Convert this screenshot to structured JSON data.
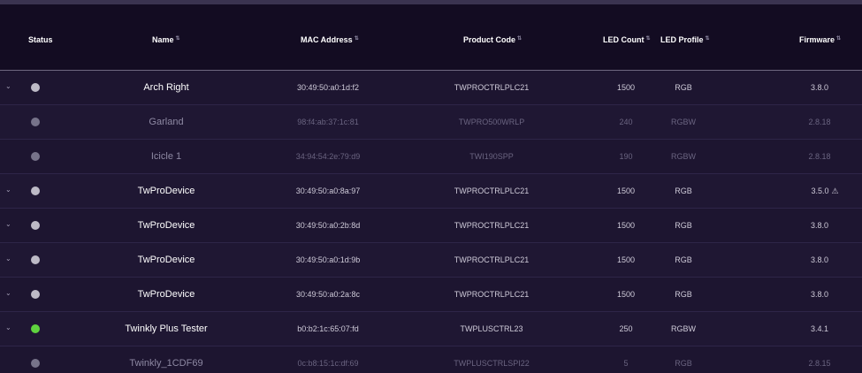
{
  "columns": {
    "status": "Status",
    "name": "Name",
    "mac": "MAC Address",
    "product": "Product Code",
    "led_count": "LED Count",
    "led_profile": "LED Profile",
    "firmware": "Firmware"
  },
  "colors": {
    "online_gray": "#bdbac6",
    "offline_gray": "#77738a",
    "online_green": "#5fd33f",
    "accent_bg": "#1d1530"
  },
  "rows": [
    {
      "name": "Arch Right",
      "mac": "30:49:50:a0:1d:f2",
      "product": "TWPROCTRLPLC21",
      "led_count": "1500",
      "led_profile": "RGB",
      "firmware": "3.8.0",
      "warning": "",
      "chevron": "⌄",
      "status": "online"
    },
    {
      "name": "Garland",
      "mac": "98:f4:ab:37:1c:81",
      "product": "TWPRO500WRLP",
      "led_count": "240",
      "led_profile": "RGBW",
      "firmware": "2.8.18",
      "warning": "",
      "chevron": "",
      "status": "offline"
    },
    {
      "name": "Icicle 1",
      "mac": "34:94:54:2e:79:d9",
      "product": "TWI190SPP",
      "led_count": "190",
      "led_profile": "RGBW",
      "firmware": "2.8.18",
      "warning": "",
      "chevron": "",
      "status": "offline"
    },
    {
      "name": "TwProDevice",
      "mac": "30:49:50:a0:8a:97",
      "product": "TWPROCTRLPLC21",
      "led_count": "1500",
      "led_profile": "RGB",
      "firmware": "3.5.0",
      "warning": "⚠",
      "chevron": "⌄",
      "status": "online"
    },
    {
      "name": "TwProDevice",
      "mac": "30:49:50:a0:2b:8d",
      "product": "TWPROCTRLPLC21",
      "led_count": "1500",
      "led_profile": "RGB",
      "firmware": "3.8.0",
      "warning": "",
      "chevron": "⌄",
      "status": "online"
    },
    {
      "name": "TwProDevice",
      "mac": "30:49:50:a0:1d:9b",
      "product": "TWPROCTRLPLC21",
      "led_count": "1500",
      "led_profile": "RGB",
      "firmware": "3.8.0",
      "warning": "",
      "chevron": "⌄",
      "status": "online"
    },
    {
      "name": "TwProDevice",
      "mac": "30:49:50:a0:2a:8c",
      "product": "TWPROCTRLPLC21",
      "led_count": "1500",
      "led_profile": "RGB",
      "firmware": "3.8.0",
      "warning": "",
      "chevron": "⌄",
      "status": "online"
    },
    {
      "name": "Twinkly Plus Tester",
      "mac": "b0:b2:1c:65:07:fd",
      "product": "TWPLUSCTRL23",
      "led_count": "250",
      "led_profile": "RGBW",
      "firmware": "3.4.1",
      "warning": "",
      "chevron": "⌄",
      "status": "online-green"
    },
    {
      "name": "Twinkly_1CDF69",
      "mac": "0c:b8:15:1c:df:69",
      "product": "TWPLUSCTRLSPI22",
      "led_count": "5",
      "led_profile": "RGB",
      "firmware": "2.8.15",
      "warning": "",
      "chevron": "",
      "status": "offline"
    }
  ]
}
